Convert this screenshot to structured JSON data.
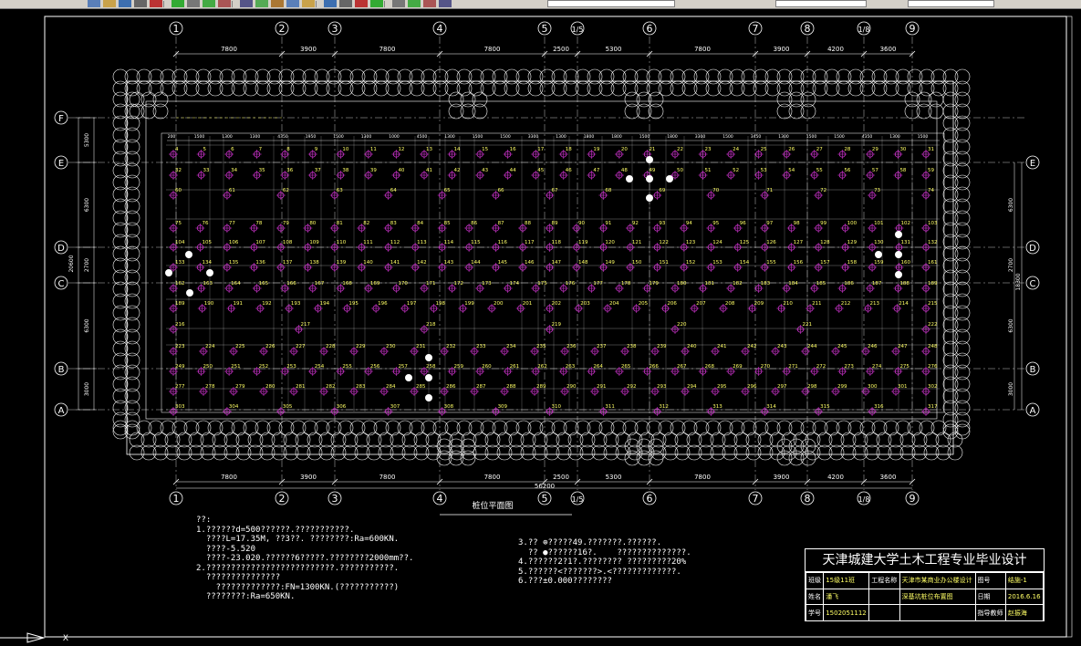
{
  "toolbar": {
    "icons": [
      "new-icon",
      "open-icon",
      "save-icon",
      "print-icon",
      "cut-icon",
      "copy-icon",
      "paste-icon",
      "undo-icon",
      "redo-icon",
      "pan-icon",
      "zoom-icon",
      "zoom-window-icon",
      "properties-icon",
      "design-center-icon",
      "text-style-icon",
      "layer-icon",
      "dimension-icon",
      "table-icon",
      "text-icon",
      "layers-icon",
      "match-icon",
      "color-icon"
    ]
  },
  "colors": {
    "background": "#000000",
    "lines": "#ffffff",
    "pile": "#cc33cc",
    "labels": "#ffff66",
    "axis": "#ffffff"
  },
  "axes": {
    "vertical": [
      "1",
      "2",
      "3",
      "4",
      "5",
      "1/5",
      "6",
      "7",
      "8",
      "1/8",
      "9"
    ],
    "horizontal": [
      "F",
      "E",
      "D",
      "C",
      "B",
      "A"
    ],
    "top_dims": [
      "7800",
      "3900",
      "7800",
      "7800",
      "2500",
      "5300",
      "7800",
      "3900",
      "4200",
      "3600"
    ],
    "bottom_dims": [
      "7800",
      "3900",
      "7800",
      "7800",
      "2500",
      "5300",
      "7800",
      "3900",
      "4200",
      "3600"
    ],
    "total_length": "56200",
    "left_dims": [
      "5300",
      "6300",
      "2700",
      "6300",
      "3000"
    ],
    "left_total": "20600",
    "right_dims": [
      "6300",
      "2700",
      "6300",
      "3000"
    ],
    "right_total": "18300"
  },
  "plan_title": "桩位平面图",
  "notes_left": [
    "??:",
    "1.??????d=500??????.???????????.",
    "  ????L=17.35M, ??3??. ????????:Ra=600KN.",
    "  ????-5.520",
    "  ????-23.020.??????6?????.????????2000mm??.",
    "2.??????????????????????????.???????????.",
    "  ???????????????",
    "    ?????????????:FN=1300KN.(???????????)",
    "  ????????:Ra=650KN."
  ],
  "notes_right": [
    "3.?? ⊕?????49.???????.??????.",
    "  ?? ●??????16?.    ??????????????.",
    "4.??????2?1?.???????? ?????????20%",
    "5.??????<???????>.<?????????????.",
    "6.???±0.000????????"
  ],
  "title_block": {
    "school": "天津城建大学土木工程专业毕业设计",
    "rows": [
      [
        "班级",
        "15级11班",
        "工程名称",
        "天津市某商业办公楼设计",
        "图号",
        "结施-1"
      ],
      [
        "姓名",
        "潘飞",
        "",
        "深基坑桩位布置图",
        "日期",
        "2016.6.16"
      ],
      [
        "学号",
        "1502051112",
        "",
        "",
        "指导教师",
        "赵振海"
      ]
    ]
  },
  "pile_numbers": {
    "row_E_top": [
      "4",
      "5",
      "6",
      "7",
      "8",
      "9",
      "10",
      "11",
      "12",
      "13",
      "14",
      "15",
      "16",
      "17",
      "18",
      "19",
      "20",
      "21",
      "22",
      "23",
      "24",
      "25",
      "26",
      "27",
      "28",
      "29",
      "30",
      "31"
    ],
    "row_E": [
      "32",
      "33",
      "34",
      "35",
      "36",
      "37",
      "38",
      "39",
      "40",
      "41",
      "42",
      "43",
      "44",
      "45",
      "46",
      "47",
      "48",
      "49",
      "50",
      "51",
      "52",
      "53",
      "54",
      "55",
      "56",
      "57",
      "58",
      "59"
    ],
    "row_mid1": [
      "60",
      "61",
      "62",
      "63",
      "64",
      "65",
      "66",
      "67",
      "68",
      "69",
      "70",
      "71",
      "72",
      "73",
      "74"
    ],
    "row_75": [
      "75",
      "76",
      "77",
      "78",
      "79",
      "80",
      "81",
      "82",
      "83",
      "84",
      "85",
      "86",
      "87",
      "88",
      "89",
      "90",
      "91",
      "92",
      "93",
      "94",
      "95",
      "96",
      "97",
      "98",
      "99",
      "100",
      "101",
      "102",
      "103"
    ],
    "row_D": [
      "104",
      "105",
      "106",
      "107",
      "108",
      "109",
      "110",
      "111",
      "112",
      "113",
      "114",
      "115",
      "116",
      "117",
      "118",
      "119",
      "120",
      "121",
      "122",
      "123",
      "124",
      "125",
      "126",
      "127",
      "128",
      "129",
      "130",
      "131",
      "132"
    ],
    "row_133": [
      "133",
      "134",
      "135",
      "136",
      "137",
      "138",
      "139",
      "140",
      "141",
      "142",
      "143",
      "144",
      "145",
      "146",
      "147",
      "148",
      "149",
      "150",
      "151",
      "152",
      "153",
      "154",
      "155",
      "156",
      "157",
      "158",
      "159",
      "160",
      "161"
    ],
    "row_C": [
      "162",
      "163",
      "164",
      "165",
      "166",
      "167",
      "168",
      "169",
      "170",
      "171",
      "172",
      "173",
      "174",
      "175",
      "176",
      "177",
      "178",
      "179",
      "180",
      "181",
      "182",
      "183",
      "184",
      "185",
      "186",
      "187",
      "188",
      "189"
    ],
    "row_189": [
      "189",
      "190",
      "191",
      "192",
      "193",
      "194",
      "195",
      "196",
      "197",
      "198",
      "199",
      "200",
      "201",
      "202",
      "203",
      "204",
      "205",
      "206",
      "207",
      "208",
      "209",
      "210",
      "211",
      "212",
      "213",
      "214",
      "215"
    ],
    "row_216": [
      "216",
      "217",
      "218",
      "219",
      "220",
      "221",
      "222"
    ],
    "row_223": [
      "223",
      "224",
      "225",
      "226",
      "227",
      "228",
      "229",
      "230",
      "231",
      "232",
      "233",
      "234",
      "235",
      "236",
      "237",
      "238",
      "239",
      "240",
      "241",
      "242",
      "243",
      "244",
      "245",
      "246",
      "247",
      "248"
    ],
    "row_B": [
      "249",
      "250",
      "251",
      "252",
      "253",
      "254",
      "255",
      "256",
      "257",
      "258",
      "259",
      "260",
      "261",
      "262",
      "263",
      "264",
      "265",
      "266",
      "267",
      "268",
      "269",
      "270",
      "271",
      "272",
      "273",
      "274",
      "275",
      "276"
    ],
    "row_277": [
      "277",
      "278",
      "279",
      "280",
      "281",
      "282",
      "283",
      "284",
      "285",
      "286",
      "287",
      "288",
      "289",
      "290",
      "291",
      "292",
      "293",
      "294",
      "295",
      "296",
      "297",
      "298",
      "299",
      "300",
      "301",
      "302"
    ],
    "row_A": [
      "303",
      "304",
      "305",
      "306",
      "307",
      "308",
      "309",
      "310",
      "311",
      "312",
      "313",
      "314",
      "315",
      "316",
      "317"
    ]
  }
}
